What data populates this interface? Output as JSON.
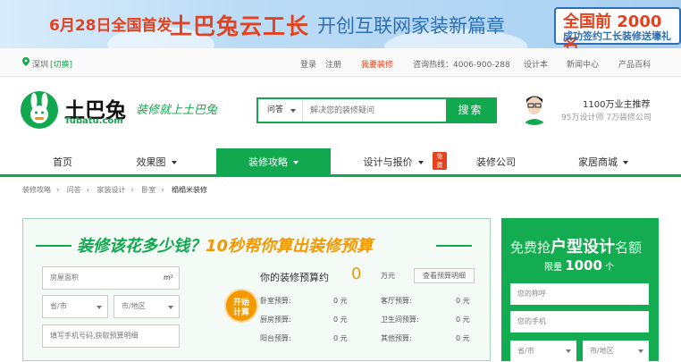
{
  "banner": {
    "date": "6月28日全国首发",
    "main": "土巴兔云工长",
    "sub": "开创互联网家装新篇章",
    "promo_line1": "全国前 2000 名",
    "promo_line2": "成功签约工长装修送壕礼"
  },
  "topbar": {
    "city": "深圳",
    "switch": "[切换]",
    "login": "登录",
    "register": "注册",
    "want_reno": "我要装修",
    "hotline": "咨询热线：4006-900-288",
    "designer": "设计本",
    "news": "新闻中心",
    "products": "产品百科"
  },
  "header": {
    "logo_text": "土巴兔",
    "logo_sub": "Tubatu.com",
    "slogan": "装修就上土巴兔",
    "search_select": "问答",
    "search_placeholder": "解决您的装修疑问",
    "search_button": "搜索",
    "promo_title": "1100万业主推荐",
    "promo_sub": "95万设计师 7万装修公司"
  },
  "nav": {
    "items": [
      {
        "label": "首页"
      },
      {
        "label": "效果图"
      },
      {
        "label": "装修攻略"
      },
      {
        "label": "设计与报价"
      },
      {
        "label": "装修公司"
      },
      {
        "label": "家居商城"
      }
    ],
    "badge": "免费"
  },
  "breadcrumb": [
    "装修攻略",
    "问答",
    "家装设计",
    "卧室",
    "榻榻米装修"
  ],
  "calc": {
    "title_a": "装修该花多少钱？",
    "title_b": "10秒帮你算出装修预算",
    "area_placeholder": "房屋面积",
    "area_unit": "m²",
    "province": "省/市",
    "city": "市/地区",
    "phone_placeholder": "填写手机号码,获取预算明细",
    "go_line1": "开始",
    "go_line2": "计算",
    "result_label": "你的装修预算约",
    "result_value": "0",
    "result_unit": "万元",
    "detail_button": "查看预算明细",
    "rows": [
      {
        "l_label": "卧室预算:",
        "l_val": "0 元",
        "r_label": "客厅预算:",
        "r_val": "0 元"
      },
      {
        "l_label": "厨房预算:",
        "l_val": "0 元",
        "r_label": "卫生间预算:",
        "r_val": "0 元"
      },
      {
        "l_label": "阳台预算:",
        "l_val": "0 元",
        "r_label": "其他预算:",
        "r_val": "0 元"
      }
    ]
  },
  "side": {
    "t1_a": "免费抢",
    "t1_b": "户型设计",
    "t1_c": "名额",
    "t2_a": "限量",
    "t2_b": "1000",
    "t2_c": "个",
    "name_placeholder": "您的称呼",
    "phone_placeholder": "您的手机",
    "province": "省/市",
    "city": "市/地区"
  },
  "colors": {
    "brand_green": "#11a84f",
    "accent_orange": "#f39800",
    "banner_red": "#e4421f"
  }
}
